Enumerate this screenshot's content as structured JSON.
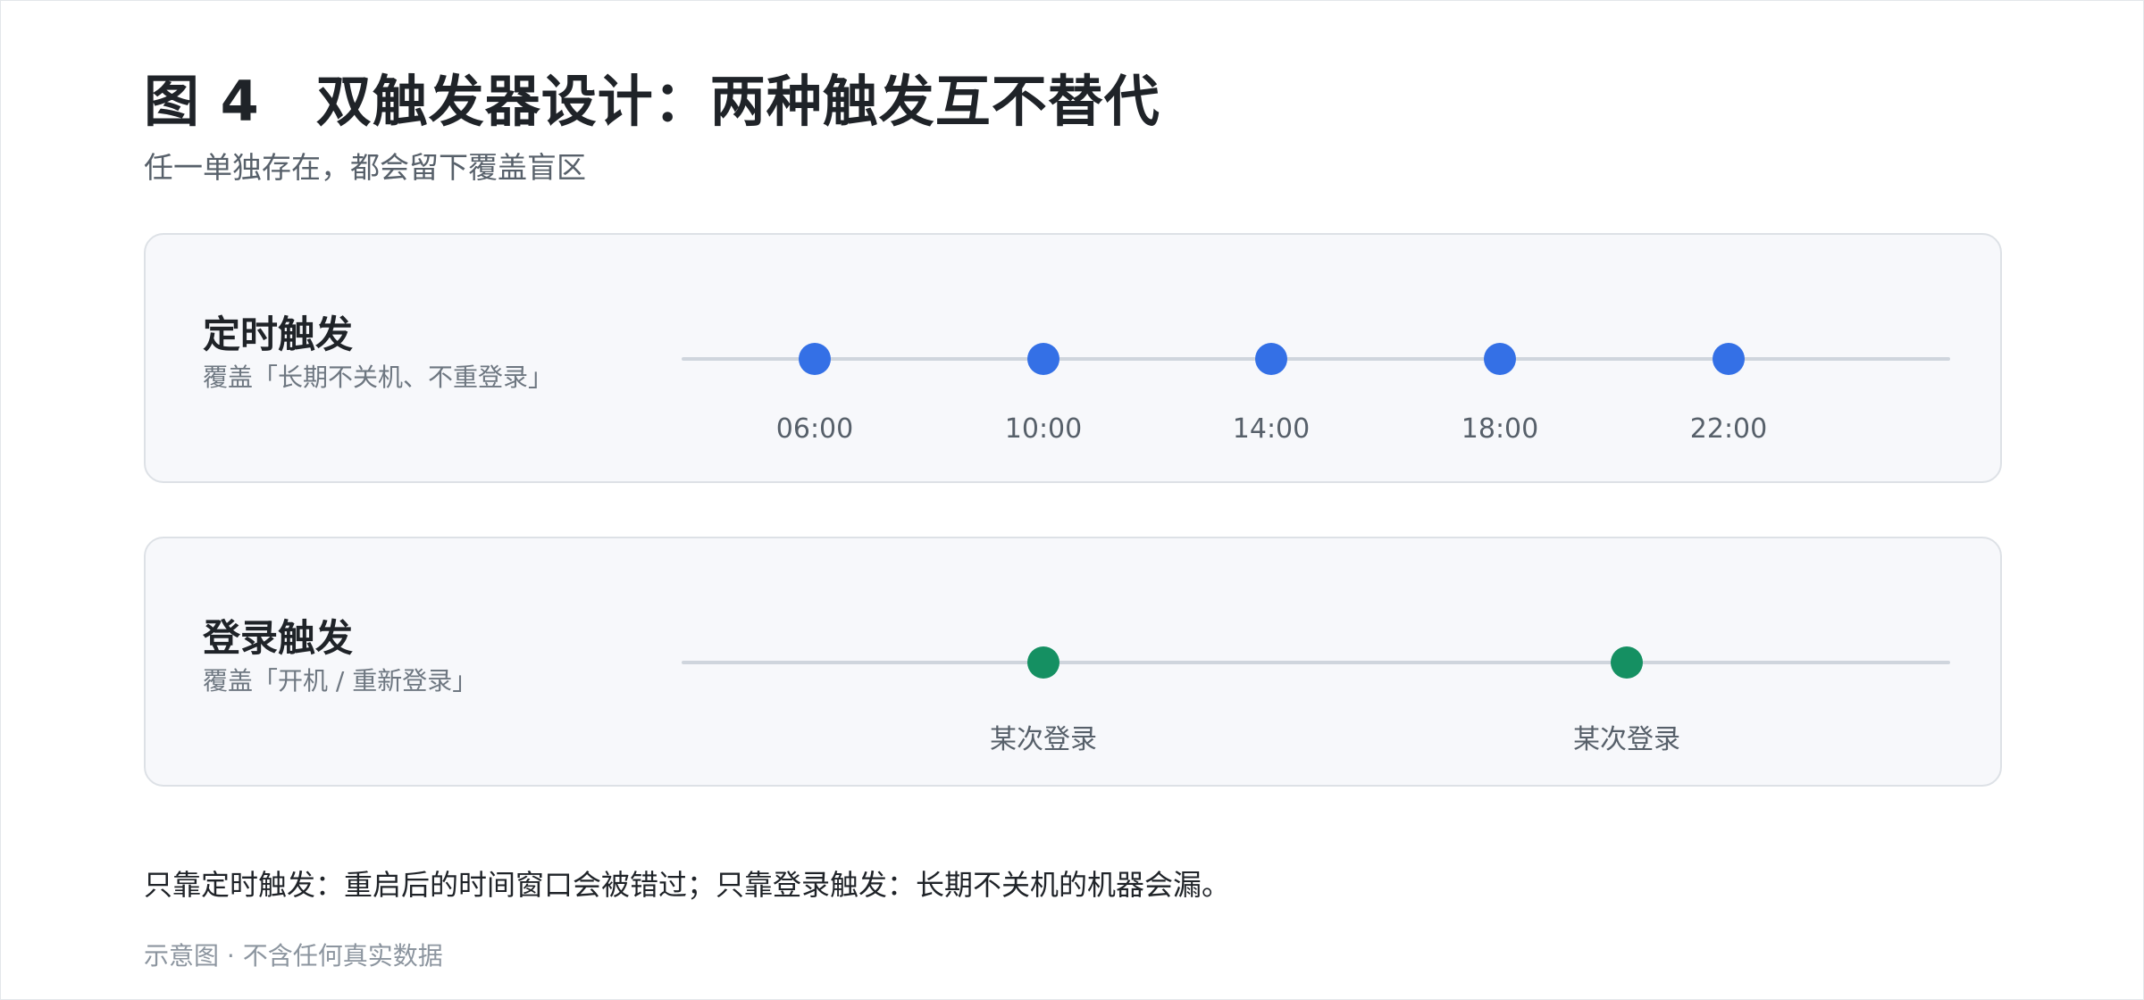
{
  "header": {
    "title": "图 4　双触发器设计：两种触发互不替代",
    "subtitle": "任一单独存在，都会留下覆盖盲区"
  },
  "panels": [
    {
      "title": "定时触发",
      "description": "覆盖「长期不关机、不重登录」",
      "dot_color": "#3470e6",
      "events": [
        {
          "label": "06:00",
          "pos": 0.105
        },
        {
          "label": "10:00",
          "pos": 0.285
        },
        {
          "label": "14:00",
          "pos": 0.465
        },
        {
          "label": "18:00",
          "pos": 0.645
        },
        {
          "label": "22:00",
          "pos": 0.825
        }
      ]
    },
    {
      "title": "登录触发",
      "description": "覆盖「开机 / 重新登录」",
      "dot_color": "#159062",
      "events": [
        {
          "label": "某次登录",
          "pos": 0.285
        },
        {
          "label": "某次登录",
          "pos": 0.745
        }
      ]
    }
  ],
  "note": "只靠定时触发：重启后的时间窗口会被错过；只靠登录触发：长期不关机的机器会漏。",
  "footer": "示意图 · 不含任何真实数据"
}
